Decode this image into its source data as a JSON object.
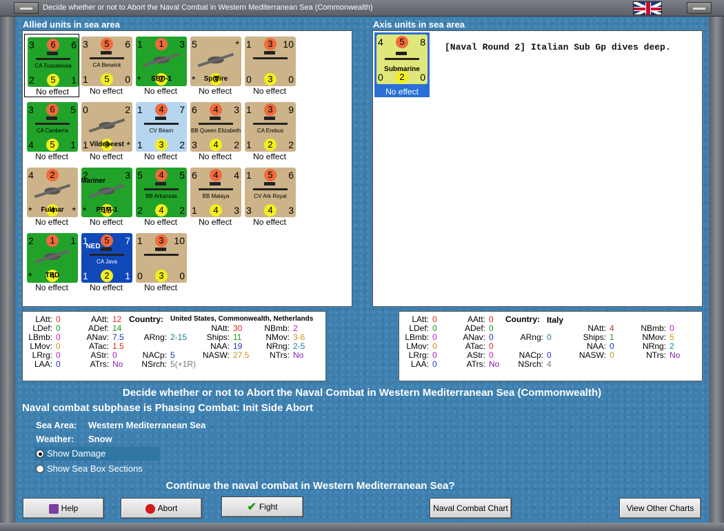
{
  "window": {
    "title": "Decide whether or not to Abort the Naval Combat in Western Mediterranean Sea (Commonwealth)"
  },
  "allied": {
    "label": "Allied units in sea area",
    "units": [
      {
        "name": "CA Tuscaloosa",
        "c": "green",
        "nw": "3",
        "ne": "6",
        "sw": "2",
        "se": "1",
        "top": "6",
        "bot": "5",
        "status": "No effect",
        "kind": "ship"
      },
      {
        "name": "CA Berwick",
        "c": "tan",
        "nw": "3",
        "ne": "6",
        "sw": "1",
        "se": "0",
        "top": "5",
        "bot": "5",
        "status": "No effect",
        "kind": "ship"
      },
      {
        "name": "SBD-1",
        "c": "green",
        "nw": "1",
        "ne": "3",
        "sw": "*",
        "se": "",
        "top": "1",
        "bot": "2",
        "status": "No effect",
        "kind": "plane"
      },
      {
        "name": "Spitfire",
        "c": "tan",
        "nw": "5",
        "ne": "*",
        "sw": "*",
        "se": "",
        "top": "",
        "bot": "3",
        "status": "No effect",
        "kind": "plane"
      },
      {
        "name": "",
        "c": "tan",
        "nw": "1",
        "ne": "10",
        "sw": "0",
        "se": "0",
        "top": "3",
        "bot": "3",
        "status": "No effect",
        "kind": "ship"
      },
      {
        "name": "CA Canberra",
        "c": "green",
        "nw": "3",
        "ne": "5",
        "sw": "4",
        "se": "1",
        "top": "6",
        "bot": "5",
        "status": "No effect",
        "kind": "ship"
      },
      {
        "name": "Vildebeest",
        "c": "tan",
        "nw": "0",
        "ne": "2",
        "sw": "1",
        "se": "*",
        "top": "",
        "bot": "9",
        "status": "No effect",
        "kind": "plane"
      },
      {
        "name": "CV Béarn",
        "c": "lblue",
        "nw": "1",
        "ne": "7",
        "sw": "1",
        "se": "2",
        "top": "4",
        "bot": "3",
        "status": "No effect",
        "kind": "ship"
      },
      {
        "name": "BB Queen Elizabeth",
        "c": "tan",
        "nw": "6",
        "ne": "3",
        "sw": "3",
        "se": "2",
        "top": "4",
        "bot": "4",
        "status": "No effect",
        "kind": "ship"
      },
      {
        "name": "CA Erebus",
        "c": "tan",
        "nw": "1",
        "ne": "9",
        "sw": "1",
        "se": "2",
        "top": "3",
        "bot": "2",
        "status": "No effect",
        "kind": "ship"
      },
      {
        "name": "Fulmar",
        "c": "tan",
        "nw": "4",
        "ne": "",
        "sw": "*",
        "se": "*",
        "top": "2",
        "bot": "4",
        "status": "No effect",
        "kind": "plane"
      },
      {
        "name": "PBM-1",
        "c": "green",
        "nw": "2",
        "ne": "3",
        "sw": "*",
        "se": "",
        "top": "",
        "bot": "15",
        "status": "No effect",
        "kind": "plane",
        "label2": "Mariner"
      },
      {
        "name": "BB Arkansas",
        "c": "green",
        "nw": "5",
        "ne": "5",
        "sw": "2",
        "se": "2",
        "top": "4",
        "bot": "4",
        "status": "No effect",
        "kind": "ship"
      },
      {
        "name": "BB Malaya",
        "c": "tan",
        "nw": "6",
        "ne": "4",
        "sw": "1",
        "se": "3",
        "top": "4",
        "bot": "4",
        "status": "No effect",
        "kind": "ship"
      },
      {
        "name": "CV Ark Royal",
        "c": "tan",
        "nw": "1",
        "ne": "6",
        "sw": "3",
        "se": "3",
        "top": "5",
        "bot": "4",
        "status": "No effect",
        "kind": "ship"
      },
      {
        "name": "TBD",
        "c": "green",
        "nw": "2",
        "ne": "1",
        "sw": "*",
        "se": "",
        "top": "1",
        "bot": "4",
        "status": "No effect",
        "kind": "plane"
      },
      {
        "name": "CA Java",
        "c": "navy",
        "nw": "1",
        "ne": "7",
        "sw": "1",
        "se": "1",
        "top": "5",
        "bot": "2",
        "status": "No effect",
        "kind": "ship",
        "label2": "NED"
      },
      {
        "name": "",
        "c": "tan",
        "nw": "1",
        "ne": "10",
        "sw": "0",
        "se": "0",
        "top": "3",
        "bot": "3",
        "status": "No effect",
        "kind": "ship"
      }
    ]
  },
  "axis": {
    "label": "Axis units in sea area",
    "message": "[Naval Round 2] Italian Sub Gp dives deep.",
    "unit": {
      "name": "Submarine",
      "nw": "4",
      "ne": "8",
      "sw": "0",
      "se": "0",
      "top": "5",
      "bot": "2",
      "status": "No effect"
    }
  },
  "allied_stats": {
    "country_label": "Country:",
    "country": "United States, Commonwealth, Netherlands",
    "LAtt": "0",
    "LDef": "0",
    "LBmb": "0",
    "LMov": "0",
    "LRrg": "0",
    "LAA": "0",
    "AAtt": "12",
    "ADef": "14",
    "ANav": "7.5",
    "ATac": "1.5",
    "AStr": "0",
    "ATrs": "No",
    "ARng": "2-15",
    "NACp": "5",
    "NSrch": "5(+1R)",
    "NAtt": "30",
    "Ships": "11",
    "NAA": "19",
    "NASW": "27.5",
    "NBmb": "2",
    "NMov": "3-6",
    "NRng": "2-5",
    "NTrs": "No"
  },
  "axis_stats": {
    "country_label": "Country:",
    "country": "Italy",
    "LAtt": "0",
    "LDef": "0",
    "LBmb": "0",
    "LMov": "0",
    "LRrg": "0",
    "LAA": "0",
    "AAtt": "0",
    "ADef": "0",
    "ANav": "0",
    "ATac": "0",
    "AStr": "0",
    "ATrs": "No",
    "ARng": "0",
    "NACp": "0",
    "NSrch": "4",
    "NAtt": "4",
    "Ships": "1",
    "NAA": "0",
    "NASW": "0",
    "NBmb": "0",
    "NMov": "5",
    "NRng": "2",
    "NTrs": "No"
  },
  "info": {
    "heading": "Decide whether or not to Abort the Naval Combat in Western Mediterranean Sea (Commonwealth)",
    "subphase": "Naval combat subphase is Phasing Combat: Init Side Abort",
    "sea_label": "Sea Area:",
    "sea_value": "Western Mediterranean Sea",
    "weather_label": "Weather:",
    "weather_value": "Snow",
    "radio_damage": "Show Damage",
    "radio_sections": "Show Sea Box Sections",
    "question": "Continue the naval combat in Western Mediterranean Sea?"
  },
  "buttons": {
    "help": "Help",
    "abort": "Abort",
    "fight": "Fight",
    "naval_chart": "Naval Combat Chart",
    "other_charts": "View Other Charts"
  }
}
